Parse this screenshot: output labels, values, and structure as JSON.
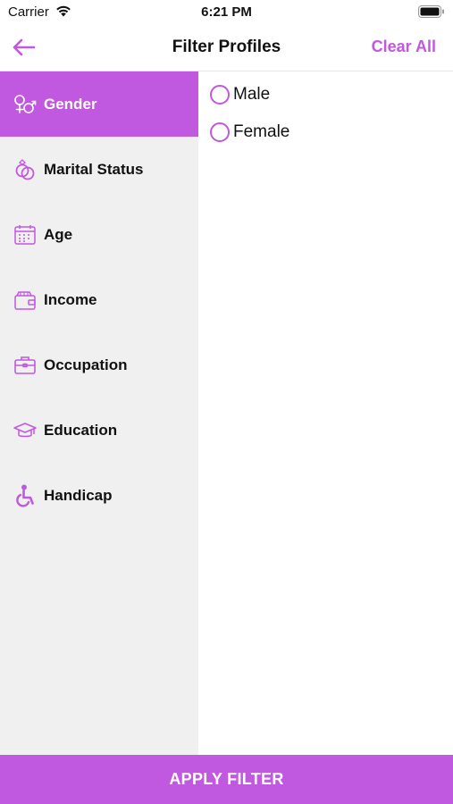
{
  "colors": {
    "accent": "#c158e0",
    "sidebar_bg": "#f0f0f0",
    "selected_text": "#ffffff"
  },
  "status_bar": {
    "carrier": "Carrier",
    "time": "6:21 PM"
  },
  "nav": {
    "back_icon": "arrow-left-icon",
    "title": "Filter Profiles",
    "clear_all_label": "Clear All"
  },
  "sidebar": {
    "items": [
      {
        "label": "Gender",
        "icon": "gender-icon",
        "selected": true
      },
      {
        "label": "Marital Status",
        "icon": "rings-icon",
        "selected": false
      },
      {
        "label": "Age",
        "icon": "calendar-icon",
        "selected": false
      },
      {
        "label": "Income",
        "icon": "wallet-icon",
        "selected": false
      },
      {
        "label": "Occupation",
        "icon": "briefcase-icon",
        "selected": false
      },
      {
        "label": "Education",
        "icon": "graduation-cap-icon",
        "selected": false
      },
      {
        "label": "Handicap",
        "icon": "wheelchair-icon",
        "selected": false
      }
    ]
  },
  "options": [
    {
      "label": "Male",
      "checked": false
    },
    {
      "label": "Female",
      "checked": false
    }
  ],
  "footer": {
    "apply_label": "APPLY FILTER"
  }
}
